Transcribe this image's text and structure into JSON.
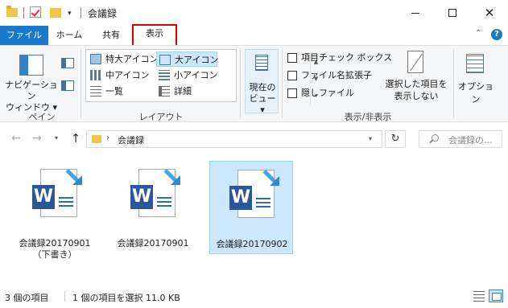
{
  "window": {
    "title": "会議録",
    "minimize_glyph": "",
    "maximize_glyph": "",
    "close_glyph": "✕"
  },
  "tabs": {
    "file": "ファイル",
    "home": "ホーム",
    "share": "共有",
    "view": "表示",
    "expand_glyph": "⌃",
    "help_glyph": "?"
  },
  "ribbon": {
    "pane": {
      "nav_pane_label": "ナビゲーション\nウィンドウ ▾",
      "group_label": "ペイン"
    },
    "layout": {
      "items": [
        "特大アイコン",
        "大アイコン",
        "中アイコン",
        "小アイコン",
        "一覧",
        "詳細"
      ],
      "selected": "大アイコン",
      "group_label": "レイアウト"
    },
    "current_view": {
      "label": "現在の\nビュー ▾"
    },
    "show_hide": {
      "item_checkboxes": "項目チェック ボックス",
      "file_extensions": "ファイル名拡張子",
      "hidden_files": "隠しファイル",
      "hide_selected": "選択した項目を\n表示しない",
      "group_label": "表示/非表示"
    },
    "options": {
      "label": "オプション"
    }
  },
  "address": {
    "path": "会議録",
    "search_placeholder": "会議録の..."
  },
  "files": [
    {
      "name": "会議録20170901\n（下書き）",
      "selected": false
    },
    {
      "name": "会議録20170901",
      "selected": false
    },
    {
      "name": "会議録20170902",
      "selected": true
    }
  ],
  "file_icon_letter": "W",
  "status": {
    "item_count": "3 個の項目",
    "selection": "1 個の項目を選択  11.0 KB"
  },
  "colors": {
    "accent": "#1979ca",
    "highlight_border": "#dd0000",
    "word_blue": "#2b579a",
    "selection_bg": "#cce8ff"
  }
}
